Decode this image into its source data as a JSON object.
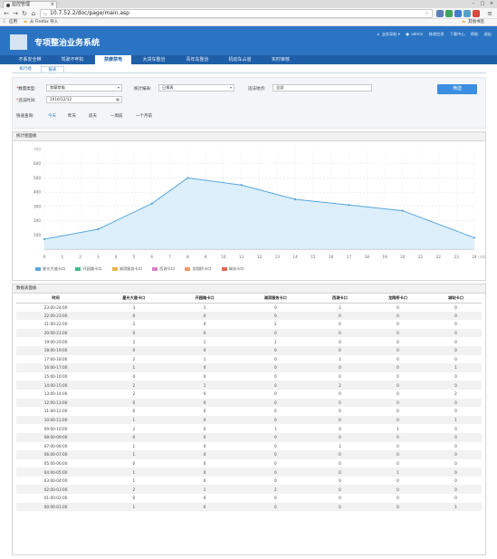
{
  "browser": {
    "tab_title": "监控管理",
    "url": "10.7.52.2/doc/page/main.asp",
    "bookmarks": [
      "应用",
      "从 Firefox 导入"
    ],
    "other_bookmarks": "其他书签"
  },
  "header": {
    "system_title": "专项整治业务系统",
    "links": [
      "业务导航 ▾",
      "admin",
      "修改信息",
      "下载中心",
      "帮助",
      "退出"
    ]
  },
  "main_nav": [
    {
      "label": "不系安全带",
      "active": false
    },
    {
      "label": "驾驶不牢扣",
      "active": false
    },
    {
      "label": "禁摩禁电",
      "active": true
    },
    {
      "label": "大货车整治",
      "active": false
    },
    {
      "label": "青年车整治",
      "active": false
    },
    {
      "label": "机动车占道",
      "active": false
    },
    {
      "label": "实时审核",
      "active": false
    }
  ],
  "sub_tabs": [
    {
      "label": "排行榜",
      "active": false
    },
    {
      "label": "报表",
      "active": true
    }
  ],
  "filter": {
    "data_type_label": "数量类型:",
    "data_type_value": "禁摩禁电",
    "stat_type_label": "统计报表:",
    "stat_type_value": "日报表",
    "location_label": "违法地点:",
    "location_value": "全部",
    "time_label": "违法时间:",
    "time_value": "2016/12/12",
    "search_label": "筛选",
    "quick_label": "快速查询:",
    "quick_links": [
      {
        "label": "今天",
        "active": true
      },
      {
        "label": "昨天",
        "active": false
      },
      {
        "label": "前天",
        "active": false
      },
      {
        "label": "一周前",
        "active": false
      },
      {
        "label": "一个月前",
        "active": false
      }
    ]
  },
  "chart_panel_title": "统计图面板",
  "chart_data": {
    "type": "area",
    "x": [
      0,
      3,
      6,
      8,
      11,
      14,
      17,
      20,
      24
    ],
    "y": [
      70,
      140,
      320,
      500,
      450,
      350,
      310,
      270,
      80
    ],
    "xticks": [
      0,
      1,
      2,
      3,
      4,
      5,
      6,
      7,
      8,
      9,
      10,
      11,
      12,
      13,
      14,
      15,
      16,
      17,
      18,
      19,
      20,
      21,
      22,
      23,
      24
    ],
    "yticks": [
      100,
      200,
      300,
      400,
      500,
      600
    ],
    "xlim": [
      0,
      24
    ],
    "ylim": [
      0,
      700
    ],
    "y_top_label": "700",
    "x_end_label": "小时",
    "grid": true,
    "legend_position": "bottom-left",
    "legend": [
      {
        "name": "星光大道卡口",
        "color": "#58a6de"
      },
      {
        "name": "开园路卡口",
        "color": "#44bb88"
      },
      {
        "name": "湖滨服务卡口",
        "color": "#e8b84a"
      },
      {
        "name": "西湖卡口",
        "color": "#d47fc6"
      },
      {
        "name": "龙翔桥卡口",
        "color": "#ee9966"
      },
      {
        "name": "城站卡口",
        "color": "#dd6655"
      }
    ]
  },
  "table_panel_title": "数据表面板",
  "table": {
    "columns": [
      "时间",
      "星光大道卡口",
      "开园路卡口",
      "湖滨服务卡口",
      "西湖卡口",
      "龙翔桥卡口",
      "城站卡口"
    ],
    "rows": [
      [
        "23:00-24:00",
        "3",
        "1",
        "0",
        "2",
        "0",
        "0"
      ],
      [
        "22:00-23:00",
        "0",
        "0",
        "0",
        "0",
        "0",
        "0"
      ],
      [
        "21:00-22:00",
        "2",
        "0",
        "2",
        "0",
        "0",
        "0"
      ],
      [
        "20:00-21:00",
        "0",
        "0",
        "0",
        "0",
        "0",
        "0"
      ],
      [
        "19:00-20:00",
        "2",
        "1",
        "1",
        "0",
        "0",
        "0"
      ],
      [
        "18:00-19:00",
        "0",
        "0",
        "0",
        "0",
        "0",
        "0"
      ],
      [
        "17:00-18:00",
        "2",
        "1",
        "0",
        "1",
        "0",
        "0"
      ],
      [
        "16:00-17:00",
        "1",
        "0",
        "0",
        "0",
        "0",
        "1"
      ],
      [
        "15:00-16:00",
        "0",
        "0",
        "0",
        "0",
        "0",
        "0"
      ],
      [
        "14:00-15:00",
        "2",
        "1",
        "0",
        "2",
        "0",
        "0"
      ],
      [
        "13:00-14:00",
        "2",
        "0",
        "0",
        "0",
        "0",
        "2"
      ],
      [
        "12:00-13:00",
        "0",
        "0",
        "0",
        "0",
        "0",
        "0"
      ],
      [
        "11:00-12:00",
        "0",
        "0",
        "0",
        "0",
        "0",
        "0"
      ],
      [
        "10:00-11:00",
        "1",
        "0",
        "0",
        "0",
        "0",
        "1"
      ],
      [
        "09:00-10:00",
        "2",
        "0",
        "1",
        "0",
        "1",
        "0"
      ],
      [
        "08:00-09:00",
        "0",
        "0",
        "0",
        "0",
        "0",
        "0"
      ],
      [
        "07:00-08:00",
        "1",
        "0",
        "0",
        "1",
        "0",
        "0"
      ],
      [
        "06:00-07:00",
        "1",
        "0",
        "0",
        "0",
        "0",
        "0"
      ],
      [
        "05:00-06:00",
        "0",
        "0",
        "0",
        "0",
        "0",
        "0"
      ],
      [
        "04:00-05:00",
        "1",
        "0",
        "0",
        "0",
        "1",
        "0"
      ],
      [
        "03:00-04:00",
        "1",
        "0",
        "0",
        "0",
        "0",
        "0"
      ],
      [
        "02:00-03:00",
        "2",
        "1",
        "2",
        "0",
        "0",
        "0"
      ],
      [
        "01:00-02:00",
        "0",
        "0",
        "0",
        "0",
        "0",
        "0"
      ],
      [
        "00:00-01:00",
        "1",
        "0",
        "0",
        "0",
        "0",
        "1"
      ]
    ]
  }
}
